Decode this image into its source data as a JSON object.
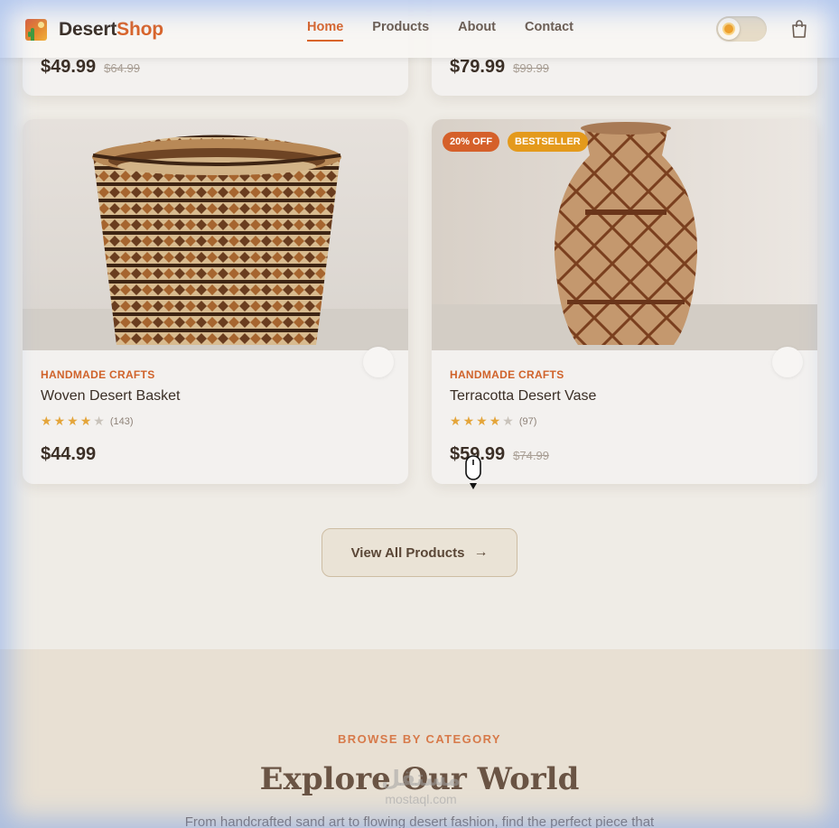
{
  "brand": {
    "name_part1": "Desert",
    "name_part2": "Shop"
  },
  "nav": {
    "items": [
      {
        "label": "Home",
        "active": true
      },
      {
        "label": "Products",
        "active": false
      },
      {
        "label": "About",
        "active": false
      },
      {
        "label": "Contact",
        "active": false
      }
    ]
  },
  "theme_toggle": {
    "mode": "light",
    "icon": "sun-icon"
  },
  "cart": {
    "icon": "shopping-bag-icon"
  },
  "top_cards": [
    {
      "price": "$49.99",
      "old_price": "$64.99"
    },
    {
      "price": "$79.99",
      "old_price": "$99.99"
    }
  ],
  "products": [
    {
      "category": "HANDMADE CRAFTS",
      "title": "Woven Desert Basket",
      "rating": 4,
      "reviews": "(143)",
      "price": "$44.99",
      "old_price": "",
      "badges": []
    },
    {
      "category": "HANDMADE CRAFTS",
      "title": "Terracotta Desert Vase",
      "rating": 4,
      "reviews": "(97)",
      "price": "$59.99",
      "old_price": "$74.99",
      "badges": [
        "20% OFF",
        "BESTSELLER"
      ]
    }
  ],
  "view_all": {
    "label": "View All Products",
    "arrow": "→"
  },
  "category_section": {
    "eyebrow": "BROWSE BY CATEGORY",
    "title": "Explore Our World",
    "description": "From handcrafted sand art to flowing desert fashion, find the perfect piece that"
  },
  "watermark": {
    "line1": "مستقل",
    "line2": "mostaql.com"
  },
  "colors": {
    "accent": "#d9642a",
    "brand_dark": "#3b2f26",
    "star": "#e4a53a",
    "badge_sale": "#d5602a",
    "badge_best": "#e49a1c"
  }
}
